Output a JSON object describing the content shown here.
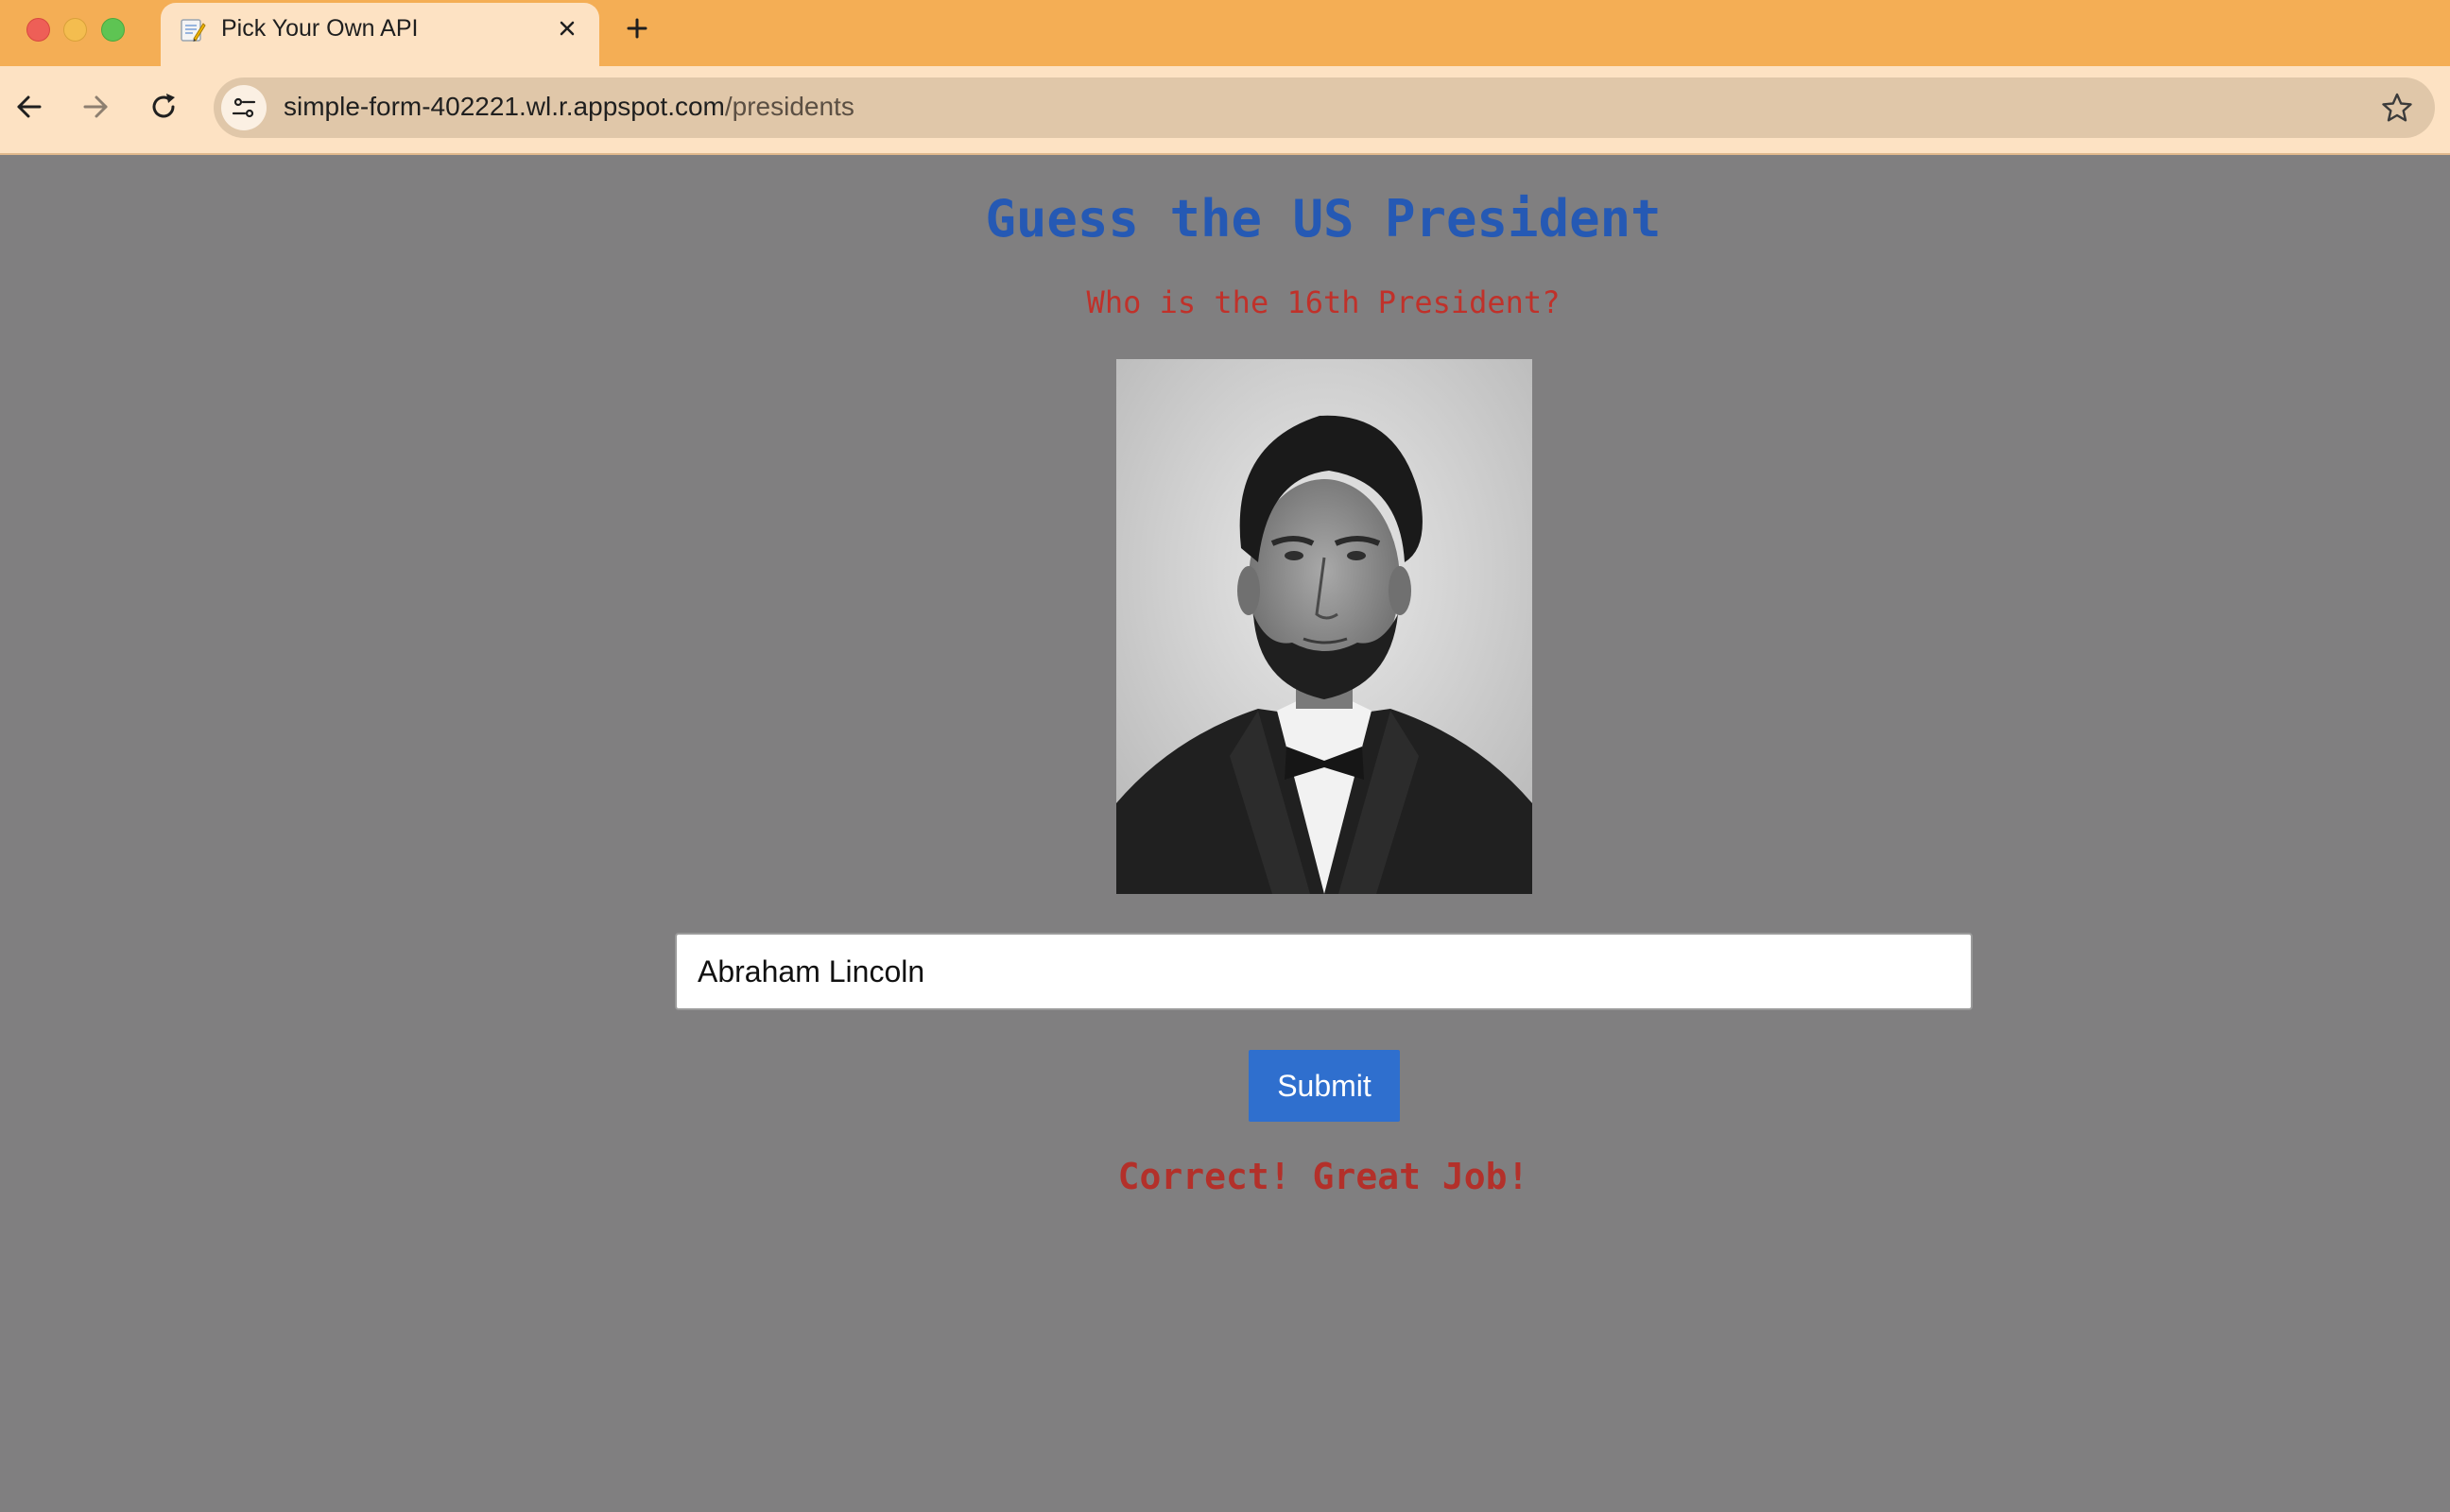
{
  "browser": {
    "tab": {
      "title": "Pick Your Own API",
      "favicon": "memo-icon"
    },
    "address_bar": {
      "domain": "simple-form-402221.wl.r.appspot.com",
      "path": "/presidents"
    }
  },
  "page": {
    "heading": "Guess the US President",
    "question": "Who is the 16th President?",
    "image": {
      "subject": "portrait-photo"
    },
    "answer_input": {
      "value": "Abraham Lincoln"
    },
    "submit_label": "Submit",
    "feedback": "Correct! Great Job!"
  },
  "colors": {
    "tabbar": "#f4ae55",
    "toolbar": "#fde2c3",
    "page_background": "#807f80",
    "heading": "#2559b4",
    "question": "#c0312a",
    "button": "#2f6fce",
    "feedback": "#b3302a"
  }
}
